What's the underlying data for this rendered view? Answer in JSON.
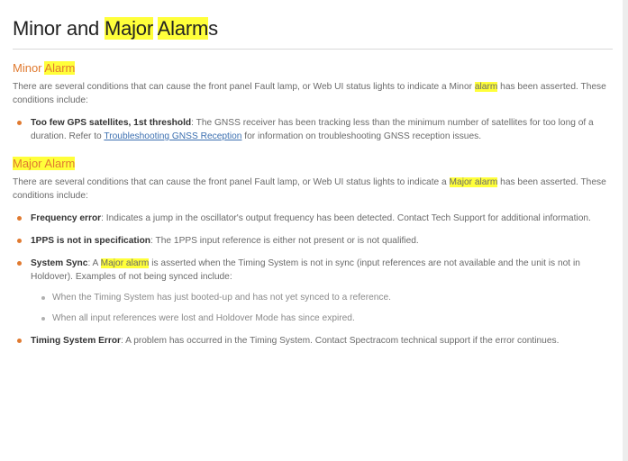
{
  "title": {
    "pre": "Minor and ",
    "hl1": "Major",
    "sp": " ",
    "hl2": "Alarm",
    "post": "s"
  },
  "minor": {
    "heading": {
      "pre": "Minor ",
      "hl": "Alarm"
    },
    "intro": {
      "pre": "There are several conditions that can cause the front panel Fault lamp, or Web UI status lights to indicate a Minor ",
      "hl": "alarm",
      "post": " has been asserted. These conditions include:"
    },
    "items": [
      {
        "term": "Too few GPS satellites, 1st threshold",
        "pre": ": The GNSS receiver has been tracking less than the minimum number of satellites for too long of a duration. Refer to ",
        "link": "Troubleshooting GNSS Reception",
        "post": " for information on troubleshooting GNSS reception issues."
      }
    ]
  },
  "major": {
    "heading": {
      "hl": "Major Alarm"
    },
    "intro": {
      "pre": "There are several conditions that can cause the front panel Fault lamp, or Web UI status lights to indicate a ",
      "hl": "Major alarm",
      "post": " has been asserted. These conditions include:"
    },
    "items": [
      {
        "term": "Frequency error",
        "text": ": Indicates a jump in the oscillator's output frequency has been detected. Contact Tech Support for additional information."
      },
      {
        "term": "1PPS is not in specification",
        "text": ": The 1PPS input reference is either not present or is not qualified."
      },
      {
        "term": "System Sync",
        "pre": ": A ",
        "hl": "Major alarm",
        "post": " is asserted when the Timing System is not in sync (input references are not available and the unit is not in Holdover). Examples of not being synced include:",
        "sub": [
          "When the Timing System has just booted-up and has not yet synced to a reference.",
          "When all input references were lost and Holdover Mode has since expired."
        ]
      },
      {
        "term": "Timing System Error",
        "text": ": A problem has occurred in the Timing System. Contact Spectracom technical support if the error continues."
      }
    ]
  },
  "colors": {
    "highlight": "#ffff3a",
    "heading_orange": "#e07a30",
    "link": "#3b6fb0"
  }
}
